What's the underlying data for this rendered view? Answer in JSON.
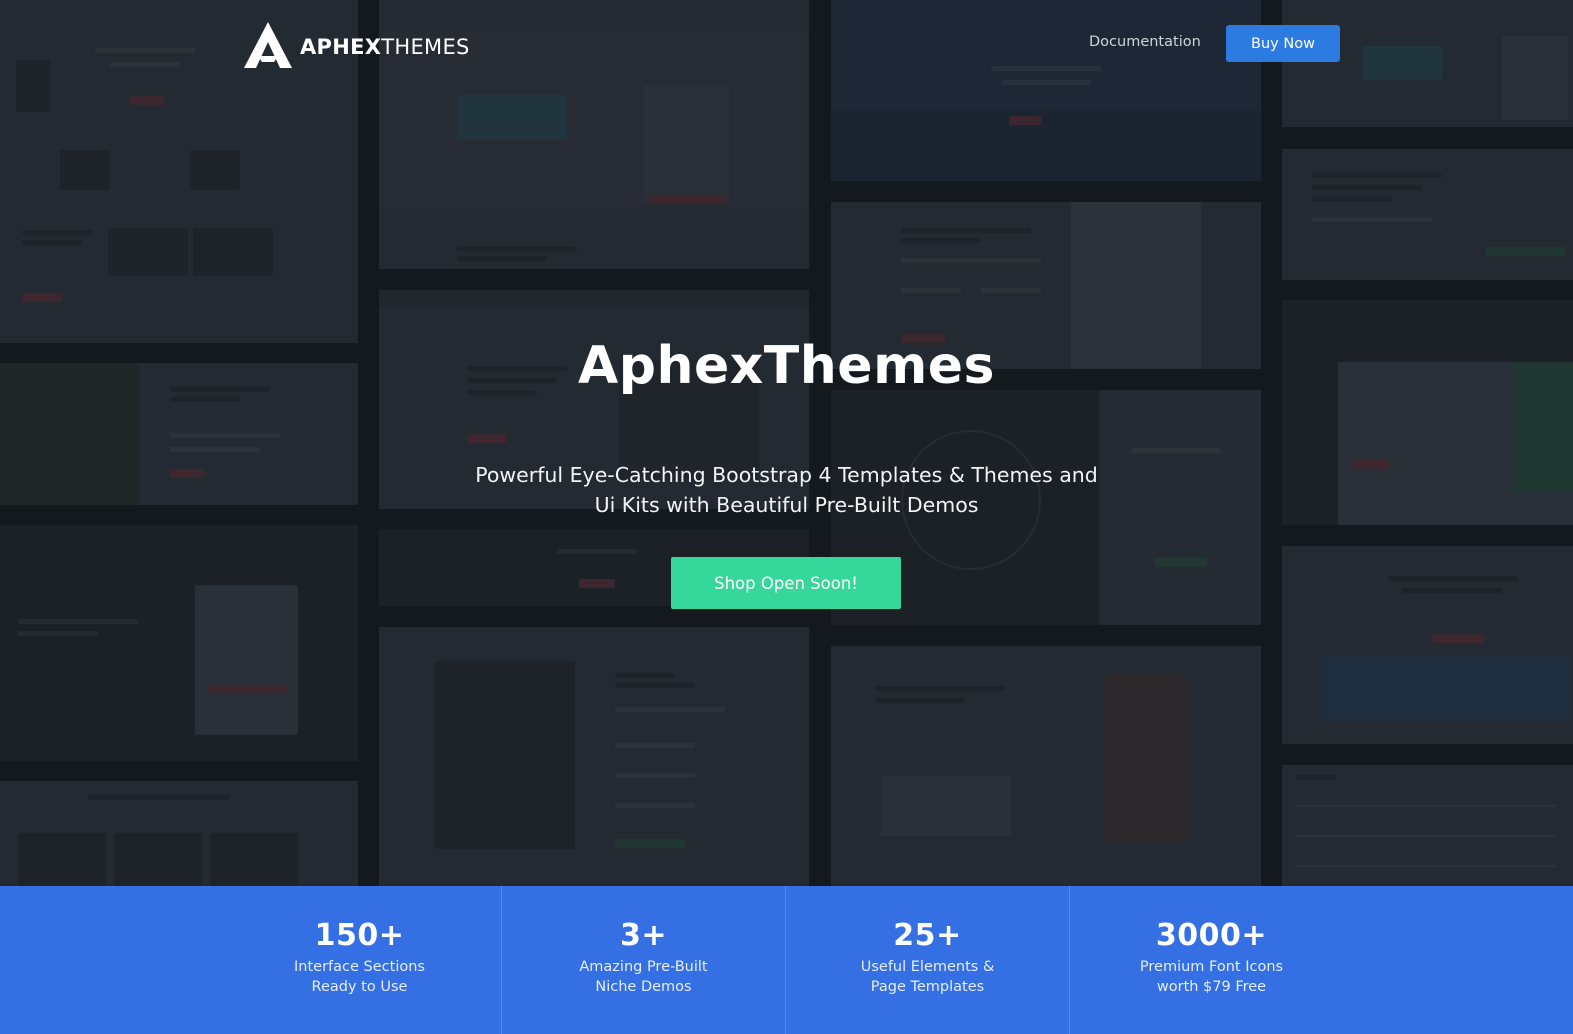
{
  "brand": {
    "name_bold": "APHEX",
    "name_light": "THEMES"
  },
  "nav": {
    "documentation": "Documentation",
    "buy_now": "Buy Now"
  },
  "hero": {
    "title": "AphexThemes",
    "subtitle_line1": "Powerful Eye-Catching Bootstrap 4 Templates & Themes and",
    "subtitle_line2": "Ui Kits with Beautiful Pre-Built Demos",
    "cta": "Shop Open Soon!"
  },
  "stats": [
    {
      "value": "150+",
      "line1": "Interface Sections",
      "line2": "Ready to Use"
    },
    {
      "value": "3+",
      "line1": "Amazing Pre-Built",
      "line2": "Niche Demos"
    },
    {
      "value": "25+",
      "line1": "Useful Elements &",
      "line2": "Page Templates"
    },
    {
      "value": "3000+",
      "line1": "Premium Font Icons",
      "line2": "worth $79 Free"
    }
  ],
  "colors": {
    "accent_blue": "#2b7be0",
    "cta_green": "#36d79b",
    "stats_band": "#3470e4"
  }
}
